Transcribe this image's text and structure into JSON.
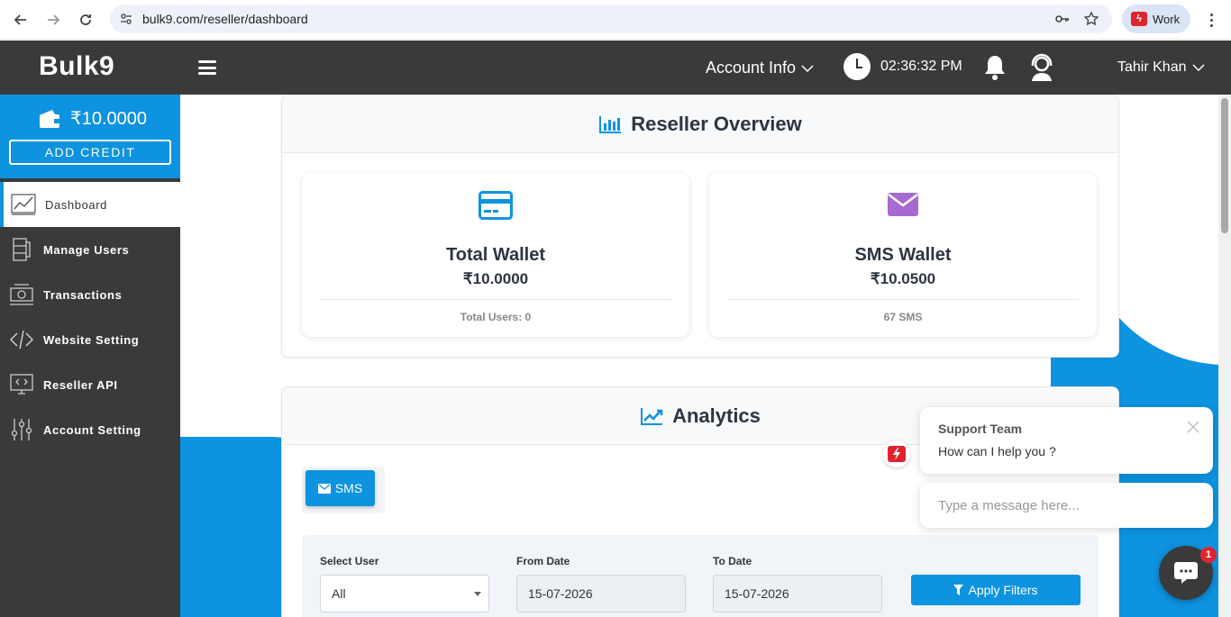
{
  "browser": {
    "url": "bulk9.com/reseller/dashboard",
    "profile_label": "Work"
  },
  "header": {
    "brand": "Bulk9",
    "account_info": "Account Info",
    "time": "02:36:32 PM",
    "user_name": "Tahir Khan"
  },
  "sidebar": {
    "wallet_amount": "₹10.0000",
    "add_credit_label": "ADD CREDIT",
    "items": [
      {
        "label": "Dashboard",
        "icon": "chart-icon"
      },
      {
        "label": "Manage Users",
        "icon": "users-icon"
      },
      {
        "label": "Transactions",
        "icon": "transactions-icon"
      },
      {
        "label": "Website Setting",
        "icon": "code-icon"
      },
      {
        "label": "Reseller API",
        "icon": "api-icon"
      },
      {
        "label": "Account Setting",
        "icon": "sliders-icon"
      }
    ]
  },
  "overview": {
    "title": "Reseller Overview",
    "total_wallet": {
      "title": "Total Wallet",
      "value": "₹10.0000",
      "footer": "Total Users: 0"
    },
    "sms_wallet": {
      "title": "SMS Wallet",
      "value": "₹10.0500",
      "footer": "67 SMS"
    }
  },
  "analytics": {
    "title": "Analytics",
    "tab_sms": "SMS",
    "filters": {
      "select_user_label": "Select User",
      "select_user_value": "All",
      "from_date_label": "From Date",
      "from_date_value": "15-07-2026",
      "to_date_label": "To Date",
      "to_date_value": "15-07-2026",
      "apply_label": "Apply Filters"
    }
  },
  "chat": {
    "team": "Support Team",
    "message": "How can I help you ?",
    "input_placeholder": "Type a message here...",
    "badge_count": "1"
  },
  "colors": {
    "accent": "#0d93e0",
    "dark": "#3a3a3b",
    "sms_icon": "#a66ad1"
  }
}
